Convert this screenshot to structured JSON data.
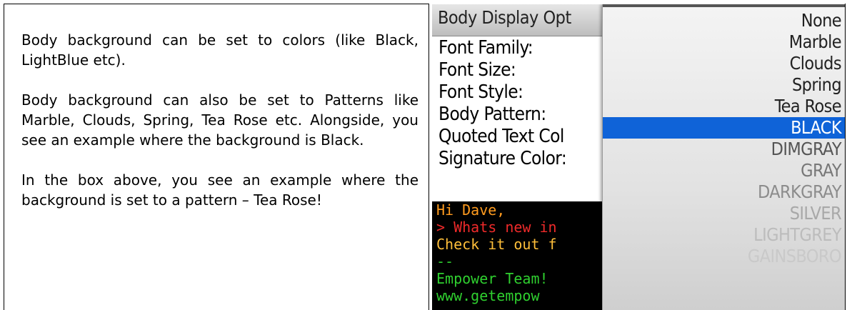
{
  "left_panel": {
    "paragraphs": [
      "Body background can be set to colors (like Black, LightBlue etc).",
      "Body background can also be set to Patterns like Marble, Clouds, Spring, Tea Rose etc. Alongside, you see an example where the background is Black.",
      "In the box above, you see an example where the background is set to a pattern – Tea Rose!"
    ]
  },
  "phone": {
    "header": "Body Display Opt",
    "options": [
      "Font Family:",
      "Font Size:",
      "Font Style:",
      "Body Pattern:",
      "Quoted Text Col",
      "Signature Color:"
    ],
    "message_lines": [
      "Hi Dave,",
      "> Whats new in",
      "Check it out f",
      "--",
      "Empower Team!",
      "www.getempow"
    ],
    "dropdown": {
      "items": [
        "None",
        "Marble",
        "Clouds",
        "Spring",
        "Tea Rose",
        "BLACK",
        "DIMGRAY",
        "GRAY",
        "DARKGRAY",
        "SILVER",
        "LIGHTGREY",
        "GAINSBORO"
      ],
      "selected": "BLACK"
    }
  },
  "colors": {
    "selection": "#0f63d8",
    "message_background": "#000000"
  }
}
